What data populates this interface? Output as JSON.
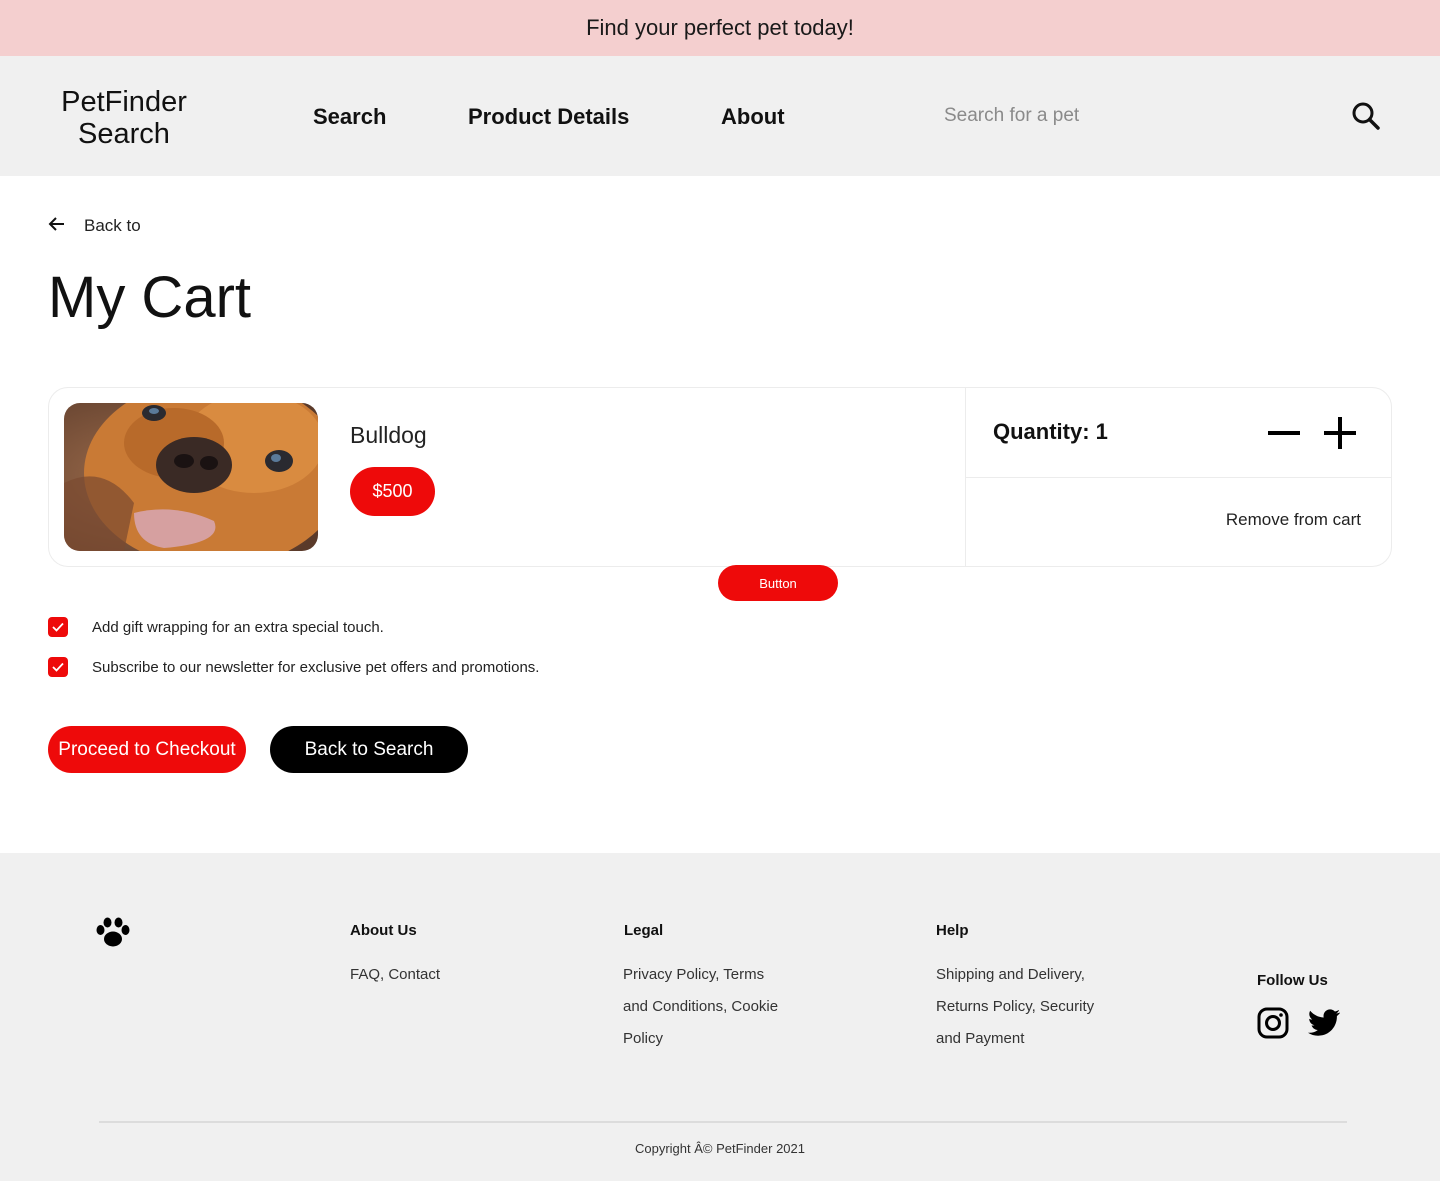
{
  "banner": {
    "text": "Find your perfect pet today!"
  },
  "header": {
    "logo_line1": "PetFinder",
    "logo_line2": "Search",
    "nav": {
      "search": "Search",
      "product_details": "Product Details",
      "about": "About"
    },
    "search_placeholder": "Search for a pet",
    "search_icon": "search-icon"
  },
  "page": {
    "back_label": "Back to",
    "title": "My Cart"
  },
  "cart": {
    "item": {
      "name": "Bulldog",
      "price": "$500",
      "image": "bulldog-photo",
      "quantity_label": "Quantity: 1",
      "remove_label": "Remove from cart"
    },
    "button_label": "Button"
  },
  "options": {
    "gift_wrap": {
      "label": "Add gift wrapping for an extra special touch.",
      "checked": true
    },
    "newsletter": {
      "label": "Subscribe to our newsletter for exclusive pet offers and promotions.",
      "checked": true
    }
  },
  "actions": {
    "checkout": "Proceed to Checkout",
    "back_to_search": "Back to Search"
  },
  "footer": {
    "logo_icon": "paw-icon",
    "about": {
      "heading": "About Us",
      "links": "FAQ, Contact"
    },
    "legal": {
      "heading": "Legal",
      "line1": "Privacy Policy, Terms",
      "line2": "and Conditions, Cookie",
      "line3": "Policy"
    },
    "help": {
      "heading": "Help",
      "line1": "Shipping and Delivery,",
      "line2": "Returns Policy, Security",
      "line3": "and Payment"
    },
    "follow": "Follow Us",
    "social": [
      "instagram-icon",
      "twitter-icon"
    ],
    "copyright": "Copyright Â© PetFinder 2021"
  },
  "colors": {
    "accent": "#ee0a0a",
    "banner": "#f4cfcf",
    "surface": "#f0f0f0"
  }
}
